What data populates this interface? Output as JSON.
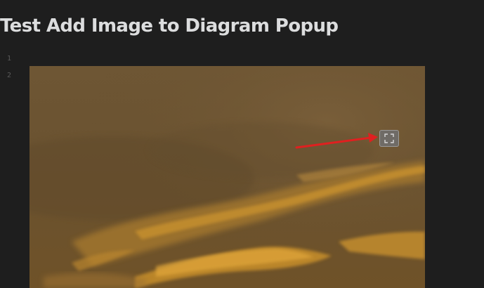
{
  "document": {
    "title": "Test Add Image to Diagram Popup",
    "line_numbers": [
      "1",
      "2"
    ]
  },
  "image_embed": {
    "expand_button_icon": "expand-icon",
    "annotation": "red-arrow-pointing-at-expand-button"
  },
  "colors": {
    "background": "#1e1e1e",
    "title_text": "#dcddde",
    "line_number_text": "#5a5a5a",
    "arrow": "#e02020"
  }
}
